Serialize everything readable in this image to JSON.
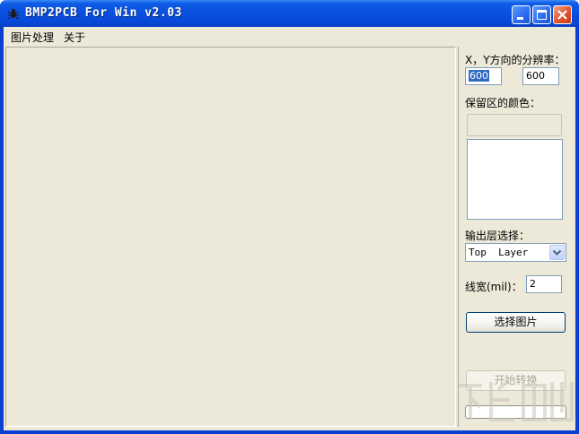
{
  "window": {
    "title": "BMP2PCB For Win v2.03"
  },
  "menu": {
    "items": [
      {
        "label": "图片处理"
      },
      {
        "label": "关于"
      }
    ]
  },
  "panel": {
    "resolution_label": "X，Y方向的分辨率：",
    "x_resolution": "600",
    "y_resolution": "600",
    "keep_color_label": "保留区的颜色：",
    "layer_label": "输出层选择：",
    "layer_selected": "Top  Layer",
    "line_width_label": "线宽(mil)：",
    "line_width": "2",
    "select_image_button": "选择图片",
    "start_convert_button": "开始转换",
    "progress_percent": 0
  },
  "colors": {
    "titlebar": "#0a4fde",
    "client_bg": "#ece9d8",
    "selection": "#316ac5",
    "close_button": "#e0542c"
  },
  "icons": {
    "app": "bug-icon",
    "minimize": "minimize-icon",
    "maximize": "maximize-icon",
    "close": "close-icon",
    "dropdown": "chevron-down-icon"
  }
}
